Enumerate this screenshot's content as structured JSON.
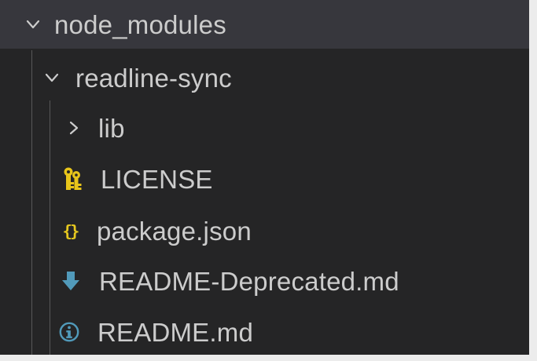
{
  "explorer": {
    "items": [
      {
        "label": "node_modules",
        "kind": "folder",
        "state": "expanded",
        "icon": "chevron-down-icon"
      },
      {
        "label": "readline-sync",
        "kind": "folder",
        "state": "expanded",
        "icon": "chevron-down-icon"
      },
      {
        "label": "lib",
        "kind": "folder",
        "state": "collapsed",
        "icon": "chevron-right-icon"
      },
      {
        "label": "LICENSE",
        "kind": "file",
        "icon": "license-key-icon"
      },
      {
        "label": "package.json",
        "kind": "file",
        "icon": "json-braces-icon"
      },
      {
        "label": "README-Deprecated.md",
        "kind": "file",
        "icon": "markdown-download-icon"
      },
      {
        "label": "README.md",
        "kind": "file",
        "icon": "info-icon"
      }
    ]
  },
  "colors": {
    "background": "#252526",
    "selected_row": "#37373d",
    "text": "#cccccc",
    "indent_guide": "#585858",
    "license_icon": "#e8c51a",
    "json_icon": "#e6c81f",
    "markdown_icon": "#519aba",
    "info_icon": "#519aba"
  }
}
